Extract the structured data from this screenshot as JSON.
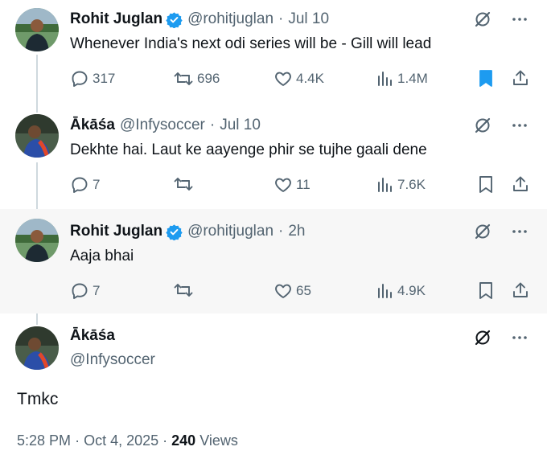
{
  "colors": {
    "text": "#0f1419",
    "muted": "#536471",
    "verified": "#1d9bf0",
    "bookmark_active": "#1d9bf0",
    "highlight_bg": "#f7f7f7",
    "thread_line": "#cfd9de"
  },
  "tweets": [
    {
      "name": "Rohit Juglan",
      "verified": true,
      "handle": "@rohitjuglan",
      "time": "Jul 10",
      "text": "Whenever India's next odi series will be - Gill will lead",
      "replies": "317",
      "retweets": "696",
      "likes": "4.4K",
      "views": "1.4M",
      "bookmarked": true
    },
    {
      "name": "Ākāśa",
      "verified": false,
      "handle": "@Infysoccer",
      "time": "Jul 10",
      "text": "Dekhte hai. Laut ke aayenge phir se tujhe gaali dene",
      "replies": "7",
      "retweets": "",
      "likes": "11",
      "views": "7.6K",
      "bookmarked": false
    },
    {
      "name": "Rohit Juglan",
      "verified": true,
      "handle": "@rohitjuglan",
      "time": "2h",
      "text": "Aaja bhai",
      "replies": "7",
      "retweets": "",
      "likes": "65",
      "views": "4.9K",
      "bookmarked": false
    }
  ],
  "main_tweet": {
    "name": "Ākāśa",
    "handle": "@Infysoccer",
    "text": "Tmkc",
    "time": "5:28 PM",
    "date": "Oct 4, 2025",
    "views_count": "240",
    "views_label": "Views"
  },
  "icons": {
    "top": [
      "grok-icon",
      "more-icon"
    ],
    "actions": [
      "reply-icon",
      "retweet-icon",
      "like-icon",
      "views-icon",
      "bookmark-icon",
      "share-icon"
    ]
  }
}
